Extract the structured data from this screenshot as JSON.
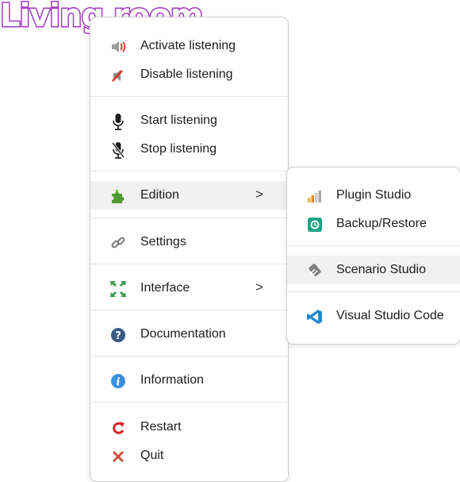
{
  "background_label": "Living room",
  "main_menu": {
    "items": [
      {
        "label": "Activate listening",
        "icon": "speaker-on-icon"
      },
      {
        "label": "Disable listening",
        "icon": "speaker-mute-icon"
      },
      {
        "label": "Start listening",
        "icon": "microphone-icon"
      },
      {
        "label": "Stop listening",
        "icon": "microphone-off-icon"
      },
      {
        "label": "Edition",
        "icon": "puzzle-icon",
        "submenu_chevron": ">"
      },
      {
        "label": "Settings",
        "icon": "chain-link-icon"
      },
      {
        "label": "Interface",
        "icon": "expand-arrows-icon",
        "submenu_chevron": ">"
      },
      {
        "label": "Documentation",
        "icon": "help-icon"
      },
      {
        "label": "Information",
        "icon": "info-icon"
      },
      {
        "label": "Restart",
        "icon": "restart-icon"
      },
      {
        "label": "Quit",
        "icon": "quit-x-icon"
      }
    ]
  },
  "sub_menu": {
    "items": [
      {
        "label": "Plugin Studio",
        "icon": "bar-chart-icon"
      },
      {
        "label": "Backup/Restore",
        "icon": "backup-icon"
      },
      {
        "label": "Scenario Studio",
        "icon": "scenario-icon"
      },
      {
        "label": "Visual Studio Code",
        "icon": "vscode-icon"
      }
    ]
  },
  "colors": {
    "room_label": "#a23ac2",
    "highlight": "#f1f1f1",
    "separator": "#dfe6ee",
    "menu_border": "#cfcfcf"
  }
}
